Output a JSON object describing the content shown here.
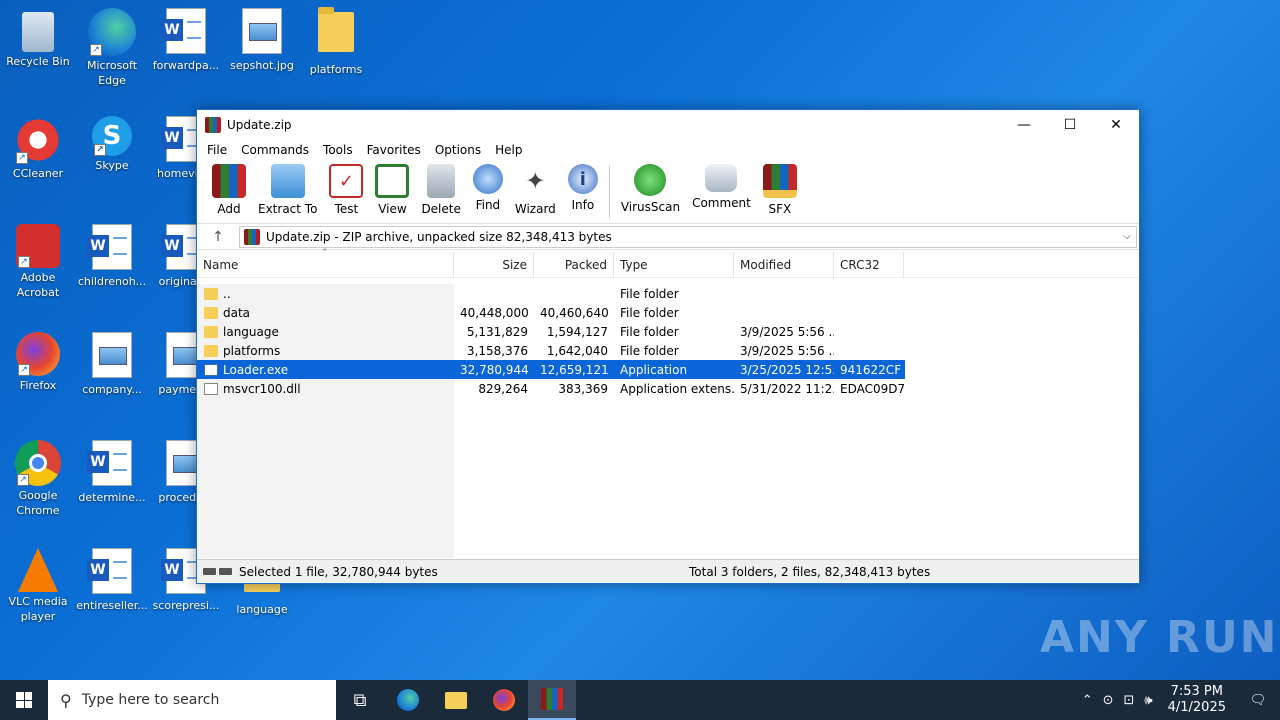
{
  "desktop": {
    "icons": [
      {
        "label": "Recycle Bin"
      },
      {
        "label": "Microsoft Edge"
      },
      {
        "label": "forwardpa..."
      },
      {
        "label": "sepshot.jpg"
      },
      {
        "label": "platforms"
      },
      {
        "label": "CCleaner"
      },
      {
        "label": "Skype"
      },
      {
        "label": "homevie..."
      },
      {
        "label": "Adobe Acrobat"
      },
      {
        "label": "childrenoh..."
      },
      {
        "label": "originall..."
      },
      {
        "label": "Firefox"
      },
      {
        "label": "company..."
      },
      {
        "label": "paymen..."
      },
      {
        "label": "Google Chrome"
      },
      {
        "label": "determine..."
      },
      {
        "label": "procedu..."
      },
      {
        "label": "VLC media player"
      },
      {
        "label": "entireseller..."
      },
      {
        "label": "scorepresi..."
      },
      {
        "label": "language"
      }
    ]
  },
  "window": {
    "title": "Update.zip",
    "menu": [
      "File",
      "Commands",
      "Tools",
      "Favorites",
      "Options",
      "Help"
    ],
    "toolbar": [
      "Add",
      "Extract To",
      "Test",
      "View",
      "Delete",
      "Find",
      "Wizard",
      "Info",
      "VirusScan",
      "Comment",
      "SFX"
    ],
    "address": "Update.zip - ZIP archive, unpacked size 82,348,413 bytes",
    "columns": {
      "name": "Name",
      "size": "Size",
      "packed": "Packed",
      "type": "Type",
      "modified": "Modified",
      "crc": "CRC32"
    },
    "files": [
      {
        "name": "..",
        "size": "",
        "packed": "",
        "type": "File folder",
        "modified": "",
        "crc": "",
        "kind": "folder"
      },
      {
        "name": "data",
        "size": "40,448,000",
        "packed": "40,460,640",
        "type": "File folder",
        "modified": "",
        "crc": "",
        "kind": "folder"
      },
      {
        "name": "language",
        "size": "5,131,829",
        "packed": "1,594,127",
        "type": "File folder",
        "modified": "3/9/2025 5:56 ...",
        "crc": "",
        "kind": "folder"
      },
      {
        "name": "platforms",
        "size": "3,158,376",
        "packed": "1,642,040",
        "type": "File folder",
        "modified": "3/9/2025 5:56 ...",
        "crc": "",
        "kind": "folder"
      },
      {
        "name": "Loader.exe",
        "size": "32,780,944",
        "packed": "12,659,121",
        "type": "Application",
        "modified": "3/25/2025 12:5...",
        "crc": "941622CF",
        "kind": "app"
      },
      {
        "name": "msvcr100.dll",
        "size": "829,264",
        "packed": "383,369",
        "type": "Application extens...",
        "modified": "5/31/2022 11:2...",
        "crc": "EDAC09D7",
        "kind": "dll"
      }
    ],
    "status_selected": "Selected 1 file, 32,780,944 bytes",
    "status_total": "Total 3 folders, 2 files, 82,348,413 bytes"
  },
  "taskbar": {
    "search_placeholder": "Type here to search",
    "time": "7:53 PM",
    "date": "4/1/2025"
  },
  "watermark": "ANY RUN"
}
